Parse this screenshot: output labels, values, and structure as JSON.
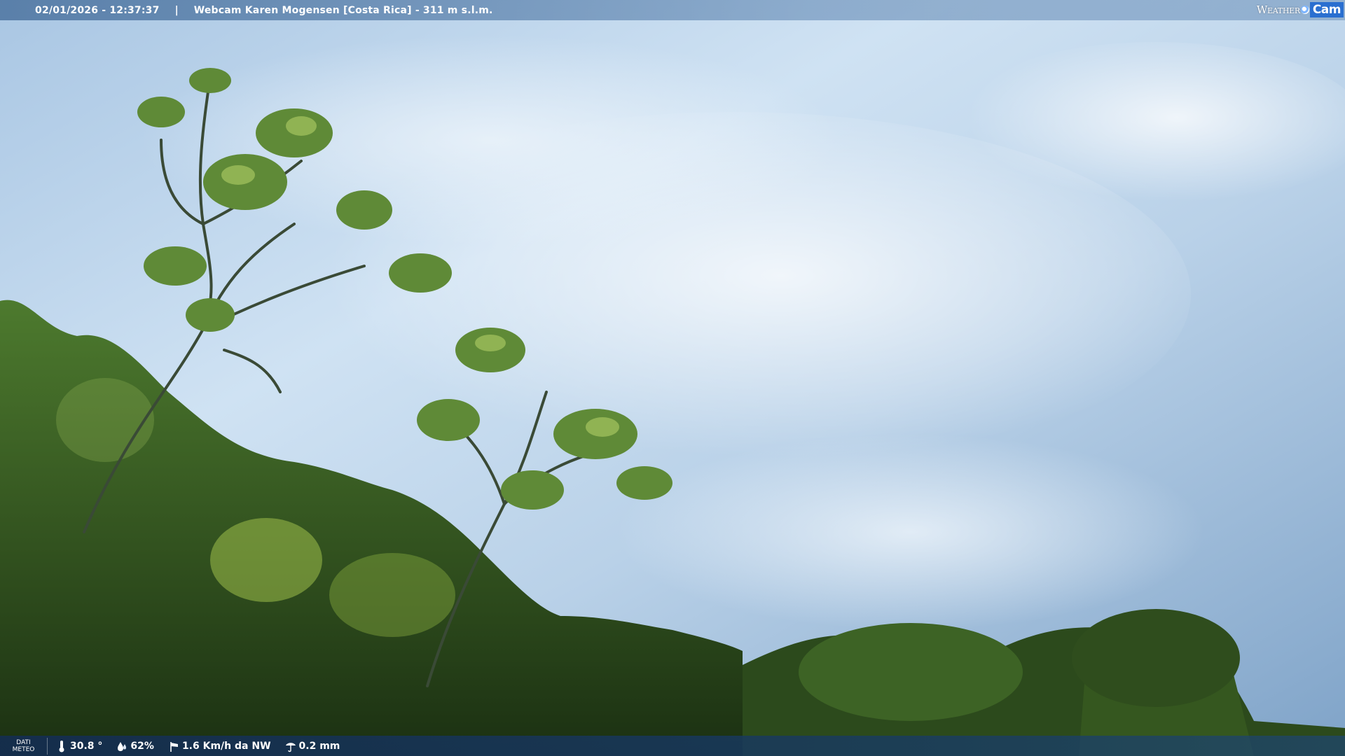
{
  "header": {
    "timestamp": "02/01/2026 - 12:37:37",
    "separator": "|",
    "title": "Webcam Karen Mogensen [Costa Rica] - 311 m s.l.m."
  },
  "logo": {
    "word1": "Weather",
    "word2": "Cam"
  },
  "weather_bar": {
    "label_line1": "DATI",
    "label_line2": "METEO",
    "temperature": "30.8 °",
    "humidity": "62%",
    "wind": "1.6 Km/h da NW",
    "rain": "0.2 mm"
  },
  "icons": [
    "thermometer-icon",
    "humidity-icon",
    "wind-icon",
    "rain-icon"
  ]
}
